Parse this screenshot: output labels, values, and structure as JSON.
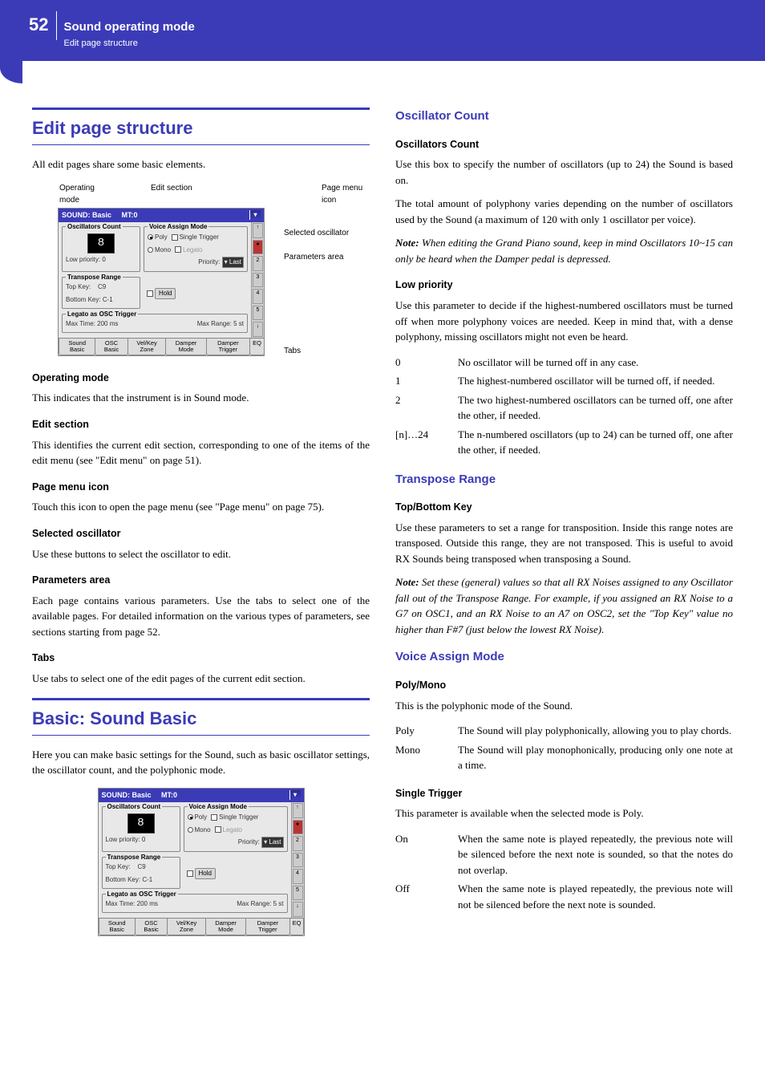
{
  "header": {
    "page_number": "52",
    "title": "Sound operating mode",
    "subtitle": "Edit page structure"
  },
  "left": {
    "sec1_title": "Edit page structure",
    "sec1_intro": "All edit pages share some basic elements.",
    "diag": {
      "label_operating_mode": "Operating mode",
      "label_edit_section": "Edit section",
      "label_page_menu_icon": "Page menu icon",
      "label_selected_osc": "Selected oscillator",
      "label_params_area": "Parameters area",
      "label_tabs": "Tabs",
      "ui_title_left": "SOUND: Basic",
      "ui_title_right": "MT:0",
      "grp_osc_count": "Oscillators Count",
      "osc_count_val": "8",
      "low_priority": "Low priority: 0",
      "grp_voice_assign": "Voice Assign Mode",
      "poly": "Poly",
      "mono": "Mono",
      "single_trigger": "Single Trigger",
      "legato": "Legato",
      "priority_label": "Priority:",
      "priority_val": "Last",
      "grp_transpose": "Transpose Range",
      "top_key": "Top Key:",
      "top_key_v": "C9",
      "bottom_key": "Bottom Key:",
      "bottom_key_v": "C-1",
      "hold": "Hold",
      "grp_legato": "Legato as OSC Trigger",
      "max_time": "Max Time: 200   ms",
      "max_range": "Max Range: 5    st",
      "tab1": "Sound Basic",
      "tab2": "OSC Basic",
      "tab3": "Vel/Key Zone",
      "tab4": "Damper Mode",
      "tab5": "Damper Trigger",
      "tab6": "EQ"
    },
    "h_operating_mode": "Operating mode",
    "p_operating_mode": "This indicates that the instrument is in Sound mode.",
    "h_edit_section": "Edit section",
    "p_edit_section": "This identifies the current edit section, corresponding to one of the items of the edit menu (see \"Edit menu\" on page 51).",
    "h_page_menu": "Page menu icon",
    "p_page_menu": "Touch this icon to open the page menu (see \"Page menu\" on page 75).",
    "h_selected_osc": "Selected oscillator",
    "p_selected_osc": "Use these buttons to select the oscillator to edit.",
    "h_params_area": "Parameters area",
    "p_params_area": "Each page contains various parameters. Use the tabs to select one of the available pages. For detailed information on the various types of parameters, see sections starting from page 52.",
    "h_tabs": "Tabs",
    "p_tabs": "Use tabs to select one of the edit pages of the current edit section.",
    "sec2_title": "Basic: Sound Basic",
    "sec2_intro": "Here you can make basic settings for the Sound, such as basic oscillator settings, the oscillator count, and the polyphonic mode."
  },
  "right": {
    "h_osc_count": "Oscillator Count",
    "h_osc_count2": "Oscillators Count",
    "p_osc_count1": "Use this box to specify the number of oscillators (up to 24) the Sound is based on.",
    "p_osc_count2": "The total amount of polyphony varies depending on the number of oscillators used by the Sound (a maximum of 120 with only 1 oscillator per voice).",
    "note_osc": "When editing the Grand Piano sound, keep in mind Oscillators 10~15 can only be heard when the Damper pedal is depressed.",
    "note_label": "Note:",
    "h_low_priority": "Low priority",
    "p_low_priority": "Use this parameter to decide if the highest-numbered oscillators must be turned off when more polyphony voices are needed. Keep in mind that, with a dense polyphony, missing oscillators might not even be heard.",
    "lp_rows": [
      {
        "k": "0",
        "v": "No oscillator will be turned off in any case."
      },
      {
        "k": "1",
        "v": "The highest-numbered oscillator will be turned off, if needed."
      },
      {
        "k": "2",
        "v": "The two highest-numbered oscillators can be turned off, one after the other, if needed."
      },
      {
        "k": "[n]…24",
        "v": "The n-numbered oscillators (up to 24) can be turned off, one after the other, if needed."
      }
    ],
    "h_transpose": "Transpose Range",
    "h_topbottom": "Top/Bottom Key",
    "p_topbottom": "Use these parameters to set a range for transposition. Inside this range notes are transposed. Outside this range, they are not transposed. This is useful to avoid RX Sounds being transposed when transposing a Sound.",
    "note_transpose": "Set these (general) values so that all RX Noises assigned to any Oscillator fall out of the Transpose Range. For example, if you assigned an RX Noise to a G7 on OSC1, and an RX Noise to an A7 on OSC2, set the \"Top Key\" value no higher than F#7 (just below the lowest RX Noise).",
    "h_voice_assign": "Voice Assign Mode",
    "h_polymono": "Poly/Mono",
    "p_polymono": "This is the polyphonic mode of the Sound.",
    "pm_rows": [
      {
        "k": "Poly",
        "v": "The Sound will play polyphonically, allowing you to play chords."
      },
      {
        "k": "Mono",
        "v": "The Sound will play monophonically, producing only one note at a time."
      }
    ],
    "h_single_trigger": "Single Trigger",
    "p_single_trigger": "This parameter is available when the selected mode is Poly.",
    "st_rows": [
      {
        "k": "On",
        "v": "When the same note is played repeatedly, the previous note will be silenced before the next note is sounded, so that the notes do not overlap."
      },
      {
        "k": "Off",
        "v": "When the same note is played repeatedly, the previous note will not be silenced before the next note is sounded."
      }
    ]
  }
}
